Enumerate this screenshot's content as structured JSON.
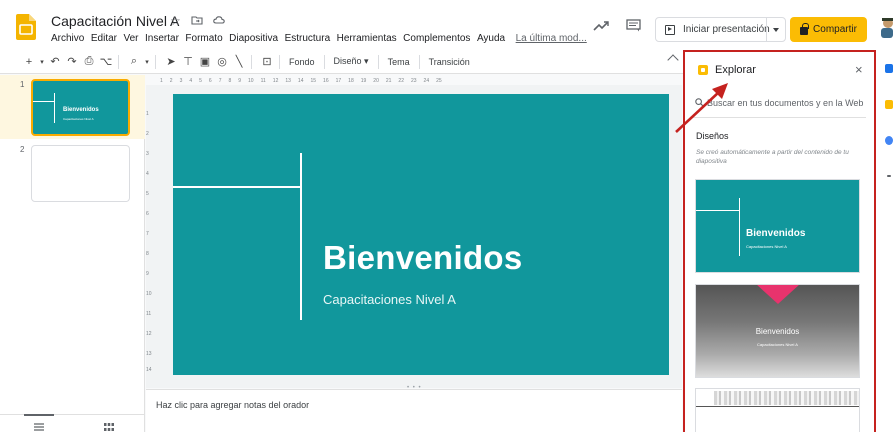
{
  "header": {
    "doc_title": "Capacitación Nivel A",
    "menu": [
      "Archivo",
      "Editar",
      "Ver",
      "Insertar",
      "Formato",
      "Diapositiva",
      "Estructura",
      "Herramientas",
      "Complementos",
      "Ayuda"
    ],
    "last_edit": "La última mod...",
    "present_label": "Iniciar presentación",
    "share_label": "Compartir"
  },
  "toolbar": {
    "background_label": "Fondo",
    "layout_label": "Diseño",
    "theme_label": "Tema",
    "transition_label": "Transición"
  },
  "ruler": {
    "top_ticks": [
      "1",
      "2",
      "3",
      "4",
      "5",
      "6",
      "7",
      "8",
      "9",
      "10",
      "11",
      "12",
      "13",
      "14",
      "15",
      "16",
      "17",
      "18",
      "19",
      "20",
      "21",
      "22",
      "23",
      "24",
      "25"
    ],
    "left_ticks": [
      "1",
      "2",
      "3",
      "4",
      "5",
      "6",
      "7",
      "8",
      "9",
      "10",
      "11",
      "12",
      "13",
      "14"
    ]
  },
  "filmstrip": {
    "slides": [
      {
        "number": "1",
        "title": "Bienvenidos",
        "subtitle": "Capacitaciones Nivel A"
      },
      {
        "number": "2"
      }
    ]
  },
  "slide": {
    "title": "Bienvenidos",
    "subtitle": "Capacitaciones Nivel A"
  },
  "notes": {
    "placeholder": "Haz clic para agregar notas del orador"
  },
  "explore": {
    "title": "Explorar",
    "search_placeholder": "Buscar en tus documentos y en la Web",
    "designs_heading": "Diseños",
    "designs_subtitle": "Se creó automáticamente a partir del contenido de tu diapositiva",
    "designs": [
      {
        "title": "Bienvenidos",
        "subtitle": "Capacitaciones Nivel A"
      },
      {
        "title": "Bienvenidos",
        "subtitle": "Capacitaciones Nivel A"
      },
      {}
    ]
  },
  "colors": {
    "slide_teal": "#11979c",
    "share_yellow": "#fbbc04",
    "highlight_red": "#c5221f",
    "selected_slide_bg": "#fef7e0"
  }
}
